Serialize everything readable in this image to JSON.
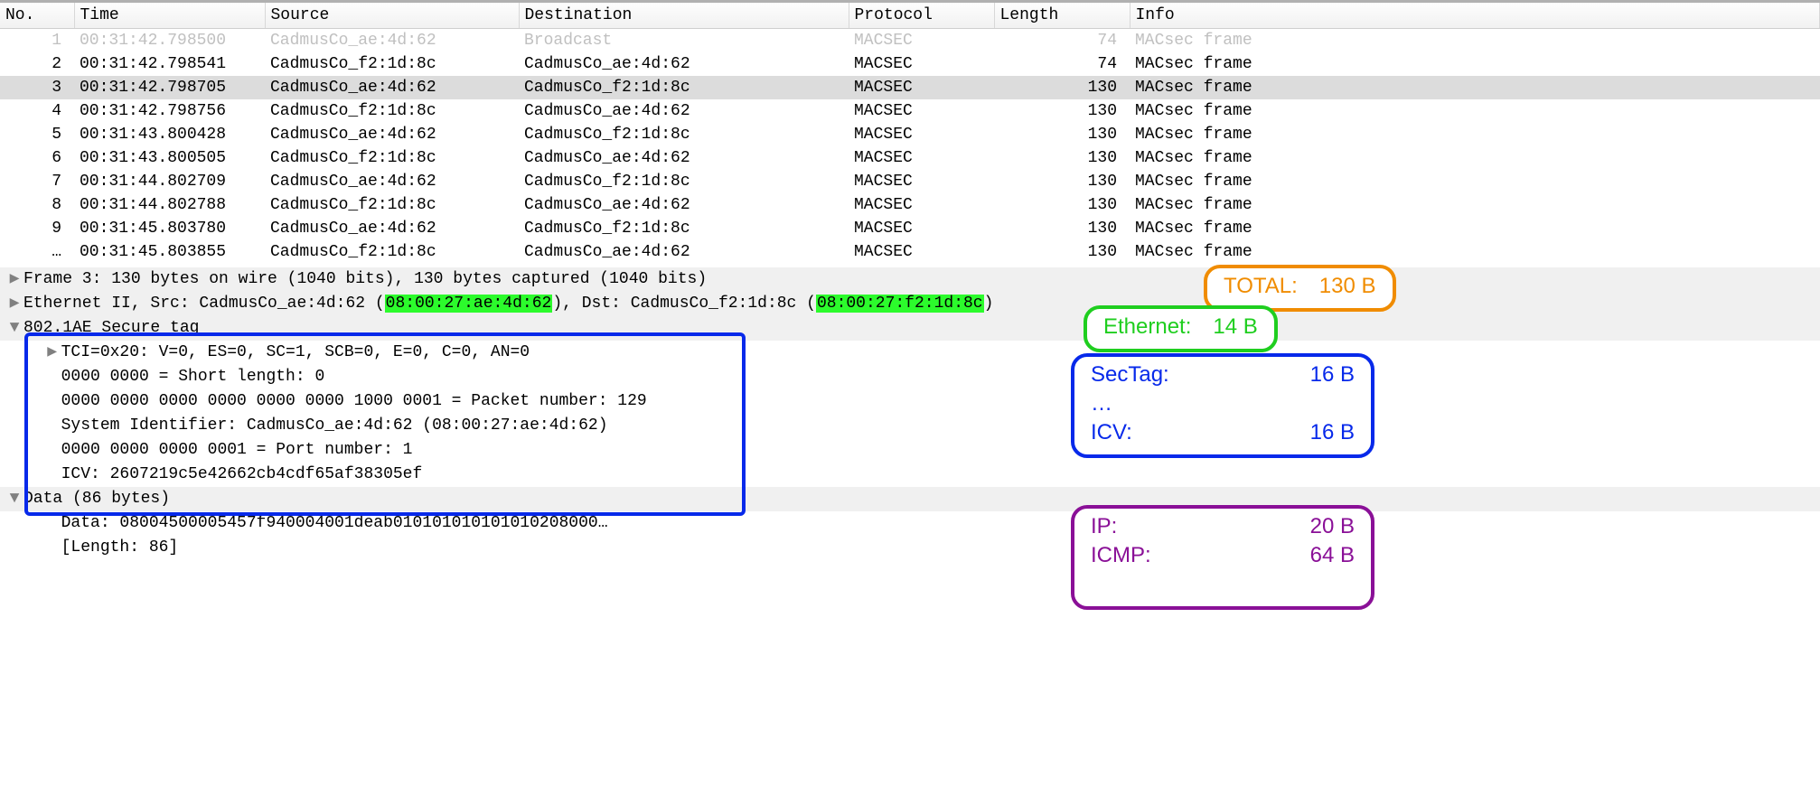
{
  "packet_list": {
    "columns": [
      "No.",
      "Time",
      "Source",
      "Destination",
      "Protocol",
      "Length",
      "Info"
    ],
    "selected_index": 2,
    "rows": [
      {
        "no": "1",
        "time": "00:31:42.798500",
        "src": "CadmusCo_ae:4d:62",
        "dst": "Broadcast",
        "proto": "MACSEC",
        "len": "74",
        "info": "MACsec frame",
        "dim": true
      },
      {
        "no": "2",
        "time": "00:31:42.798541",
        "src": "CadmusCo_f2:1d:8c",
        "dst": "CadmusCo_ae:4d:62",
        "proto": "MACSEC",
        "len": "74",
        "info": "MACsec frame"
      },
      {
        "no": "3",
        "time": "00:31:42.798705",
        "src": "CadmusCo_ae:4d:62",
        "dst": "CadmusCo_f2:1d:8c",
        "proto": "MACSEC",
        "len": "130",
        "info": "MACsec frame"
      },
      {
        "no": "4",
        "time": "00:31:42.798756",
        "src": "CadmusCo_f2:1d:8c",
        "dst": "CadmusCo_ae:4d:62",
        "proto": "MACSEC",
        "len": "130",
        "info": "MACsec frame"
      },
      {
        "no": "5",
        "time": "00:31:43.800428",
        "src": "CadmusCo_ae:4d:62",
        "dst": "CadmusCo_f2:1d:8c",
        "proto": "MACSEC",
        "len": "130",
        "info": "MACsec frame"
      },
      {
        "no": "6",
        "time": "00:31:43.800505",
        "src": "CadmusCo_f2:1d:8c",
        "dst": "CadmusCo_ae:4d:62",
        "proto": "MACSEC",
        "len": "130",
        "info": "MACsec frame"
      },
      {
        "no": "7",
        "time": "00:31:44.802709",
        "src": "CadmusCo_ae:4d:62",
        "dst": "CadmusCo_f2:1d:8c",
        "proto": "MACSEC",
        "len": "130",
        "info": "MACsec frame"
      },
      {
        "no": "8",
        "time": "00:31:44.802788",
        "src": "CadmusCo_f2:1d:8c",
        "dst": "CadmusCo_ae:4d:62",
        "proto": "MACSEC",
        "len": "130",
        "info": "MACsec frame"
      },
      {
        "no": "9",
        "time": "00:31:45.803780",
        "src": "CadmusCo_ae:4d:62",
        "dst": "CadmusCo_f2:1d:8c",
        "proto": "MACSEC",
        "len": "130",
        "info": "MACsec frame"
      },
      {
        "no": "…",
        "time": "00:31:45.803855",
        "src": "CadmusCo_f2:1d:8c",
        "dst": "CadmusCo_ae:4d:62",
        "proto": "MACSEC",
        "len": "130",
        "info": "MACsec frame"
      }
    ]
  },
  "details": {
    "frame": "Frame 3: 130 bytes on wire (1040 bits), 130 bytes captured (1040 bits)",
    "eth_pre": "Ethernet II, Src: CadmusCo_ae:4d:62 (",
    "eth_mac1": "08:00:27:ae:4d:62",
    "eth_mid": "), Dst: CadmusCo_f2:1d:8c (",
    "eth_mac2": "08:00:27:f2:1d:8c",
    "eth_post": ")",
    "sectag": "802.1AE Secure tag",
    "tci": "TCI=0x20: V=0, ES=0, SC=1, SCB=0, E=0, C=0, AN=0",
    "shortlen": "0000 0000 = Short length: 0",
    "pn": "0000 0000 0000 0000 0000 0000 1000 0001 = Packet number: 129",
    "sysid": "System Identifier: CadmusCo_ae:4d:62 (08:00:27:ae:4d:62)",
    "portnum": "0000 0000 0000 0001 = Port number: 1",
    "icv": "ICV: 2607219c5e42662cb4cdf65af38305ef",
    "data_hdr": "Data (86 bytes)",
    "data_hex": "Data: 08004500005457f940004001deab010101010101010208000…",
    "data_len": "[Length: 86]"
  },
  "twisty": {
    "closed": "▶",
    "open": "▼"
  },
  "notes": {
    "total": {
      "label": "TOTAL:",
      "value": "130 B",
      "color": "#f08c00"
    },
    "eth": {
      "label": "Ethernet:",
      "value": "14 B",
      "color": "#1fce1f"
    },
    "sectag": {
      "l1": "SecTag:",
      "v1": "16 B",
      "l2": "…",
      "l3": "ICV:",
      "v3": "16 B",
      "color": "#0729ea"
    },
    "ip": {
      "l1": "IP:",
      "v1": "20 B",
      "l2": "ICMP:",
      "v2": "64 B",
      "color": "#8a1097"
    }
  }
}
